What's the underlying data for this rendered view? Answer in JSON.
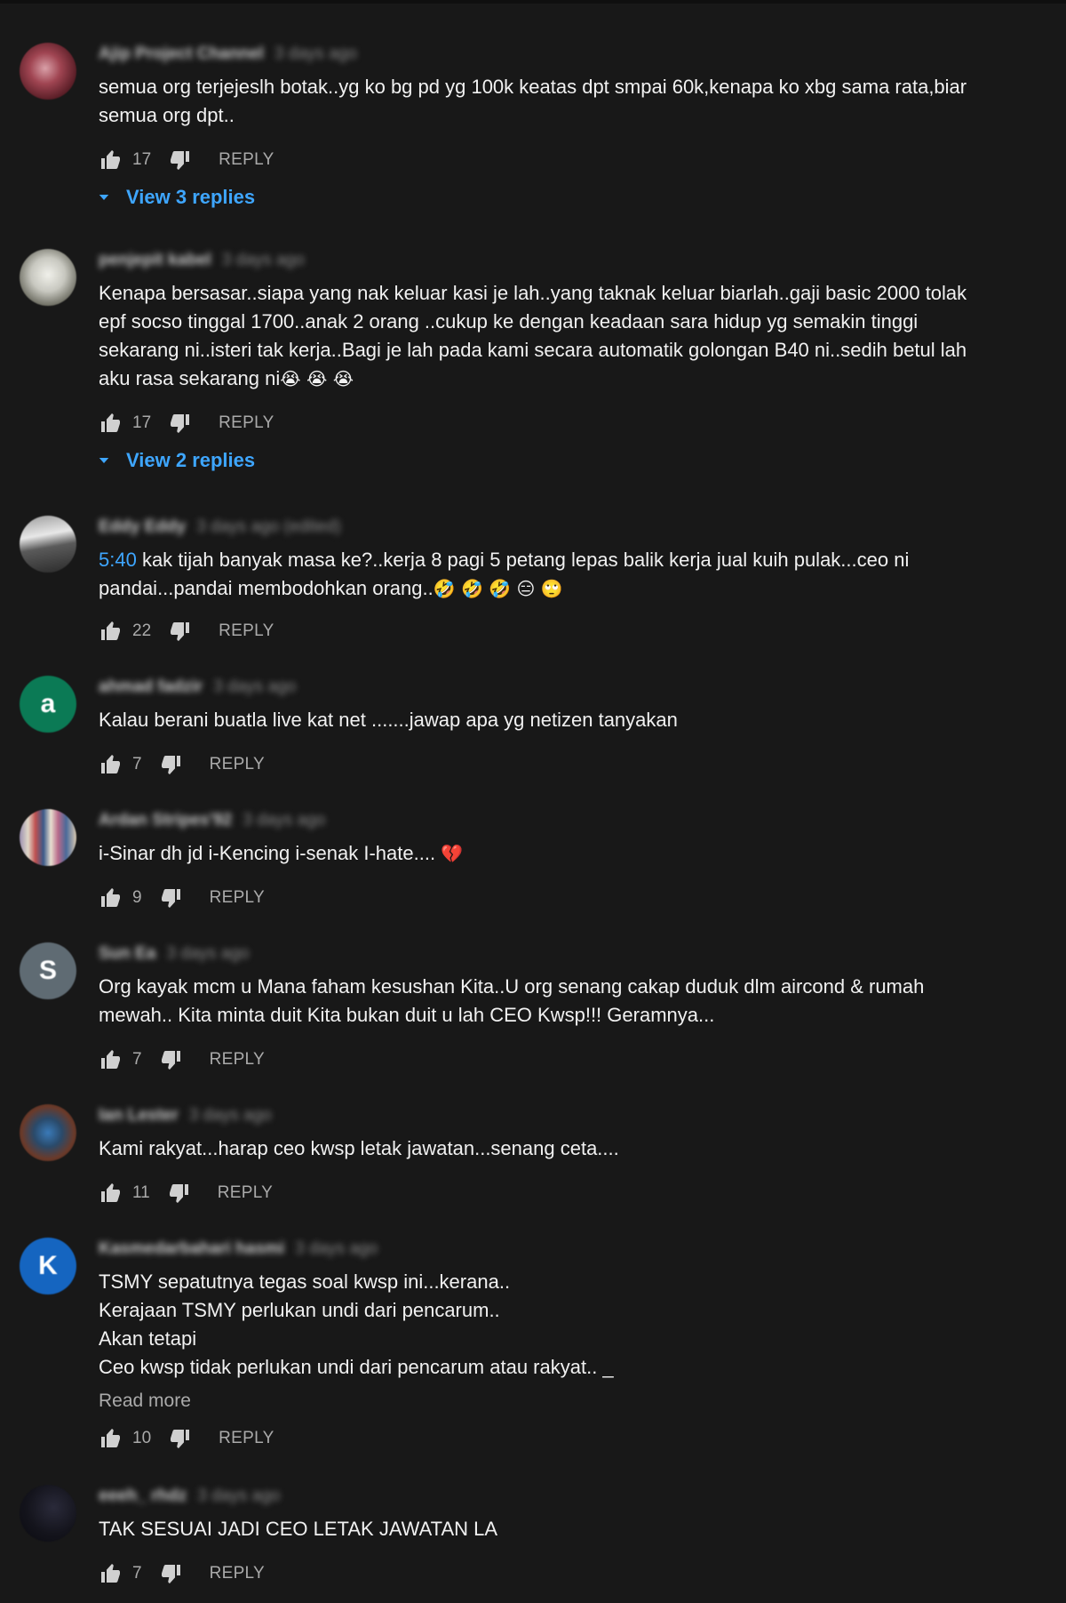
{
  "labels": {
    "reply": "REPLY"
  },
  "comments": [
    {
      "author": "Ajip Project Channel",
      "time": "3 days ago",
      "lines": [
        "semua org terjejeslh botak..yg ko bg pd yg 100k keatas dpt smpai 60k,kenapa ko xbg sama rata,biar",
        "semua org dpt.."
      ],
      "likes": "17",
      "view_replies": "View 3 replies"
    },
    {
      "author": "penjepit kabel",
      "time": "3 days ago",
      "lines": [
        "Kenapa bersasar..siapa yang nak keluar kasi je lah..yang taknak keluar biarlah..gaji basic  2000 tolak",
        "epf socso tinggal 1700..anak 2 orang ..cukup ke dengan keadaan sara hidup yg semakin tinggi",
        "sekarang ni..isteri tak kerja..Bagi je lah pada kami secara automatik golongan B40 ni..sedih betul lah"
      ],
      "last_line": "aku rasa sekarang ni",
      "emoji": "😭 😭 😭",
      "likes": "17",
      "view_replies": "View 2 replies"
    },
    {
      "author": "Eddy Eddy",
      "time": "3 days ago (edited)",
      "timestamp": "5:40",
      "first_line": " kak tijah banyak masa ke?..kerja 8 pagi 5 petang lepas balik kerja jual kuih pulak...ceo ni",
      "last_line": "pandai...pandai membodohkan orang..",
      "emoji": "🤣 🤣 🤣 😑 🙄",
      "likes": "22"
    },
    {
      "author": "ahmad fadzir",
      "time": "3 days ago",
      "avatar_letter": "a",
      "lines": [
        "Kalau berani buatla live kat net .......jawap apa yg netizen tanyakan"
      ],
      "likes": "7"
    },
    {
      "author": "Ardan Stripes'92",
      "time": "3 days ago",
      "last_line": "i-Sinar dh jd i-Kencing i-senak I-hate....",
      "emoji": "💔",
      "likes": "9"
    },
    {
      "author": "Sun Ea",
      "time": "3 days ago",
      "avatar_letter": "S",
      "lines": [
        "Org kayak mcm u Mana faham kesushan Kita..U org senang cakap duduk dlm aircond & rumah",
        "mewah.. Kita minta duit Kita bukan duit u lah CEO Kwsp!!! Geramnya..."
      ],
      "likes": "7"
    },
    {
      "author": "Ian Lester",
      "time": "3 days ago",
      "lines": [
        "Kami rakyat...harap ceo kwsp letak jawatan...senang ceta...."
      ],
      "likes": "11"
    },
    {
      "author": "Kasmedarbahari hasmi",
      "time": "3 days ago",
      "avatar_letter": "K",
      "lines": [
        "TSMY sepatutnya tegas soal kwsp ini...kerana..",
        "Kerajaan TSMY perlukan undi dari pencarum..",
        "Akan tetapi",
        "Ceo kwsp tidak perlukan undi dari pencarum atau rakyat.. _"
      ],
      "read_more": "Read more",
      "likes": "10"
    },
    {
      "author": "eeeh_ rhdz",
      "time": "3 days ago",
      "lines": [
        "TAK SESUAI JADI CEO LETAK JAWATAN LA"
      ],
      "likes": "7"
    }
  ]
}
